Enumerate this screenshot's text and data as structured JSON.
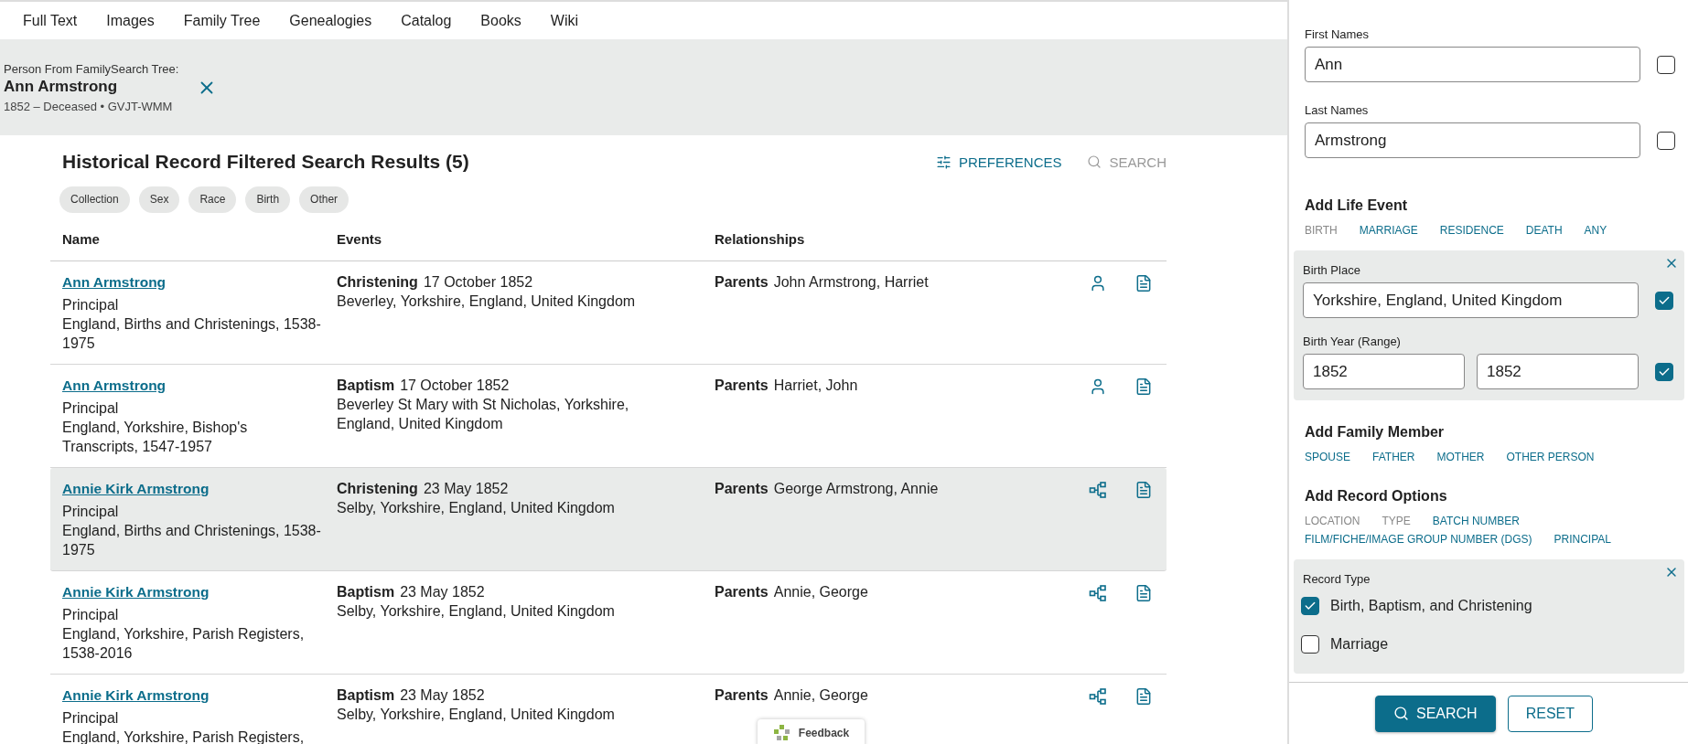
{
  "nav": {
    "items": [
      {
        "label": "Full Text"
      },
      {
        "label": "Images"
      },
      {
        "label": "Family Tree"
      },
      {
        "label": "Genealogies"
      },
      {
        "label": "Catalog"
      },
      {
        "label": "Books"
      },
      {
        "label": "Wiki"
      }
    ]
  },
  "person_banner": {
    "caption": "Person From FamilySearch Tree:",
    "name": "Ann Armstrong",
    "details": "1852 – Deceased • GVJT-WMM"
  },
  "results": {
    "title": "Historical Record Filtered Search Results (5)",
    "actions": [
      {
        "label": "PREFERENCES",
        "kind": "preferences",
        "disabled": false
      },
      {
        "label": "SEARCH",
        "kind": "search",
        "disabled": true
      }
    ],
    "filters": [
      "Collection",
      "Sex",
      "Race",
      "Birth",
      "Other"
    ],
    "columns": [
      "Name",
      "Events",
      "Relationships"
    ],
    "rows": [
      {
        "name": "Ann Armstrong",
        "role": "Principal",
        "collection": "England, Births and Christenings, 1538-1975",
        "event_type": "Christening",
        "event_date": "17 October 1852",
        "event_place": "Beverley, Yorkshire, England, United Kingdom",
        "relation_label": "Parents",
        "relation_names": "John Armstrong, Harriet",
        "kind": "person",
        "selected": false
      },
      {
        "name": "Ann Armstrong",
        "role": "Principal",
        "collection": "England, Yorkshire, Bishop's Transcripts, 1547-1957",
        "event_type": "Baptism",
        "event_date": "17 October 1852",
        "event_place": "Beverley St Mary with St Nicholas, Yorkshire, England, United Kingdom",
        "relation_label": "Parents",
        "relation_names": "Harriet, John",
        "kind": "person",
        "selected": false
      },
      {
        "name": "Annie Kirk Armstrong",
        "role": "Principal",
        "collection": "England, Births and Christenings, 1538-1975",
        "event_type": "Christening",
        "event_date": "23 May 1852",
        "event_place": "Selby, Yorkshire, England, United Kingdom",
        "relation_label": "Parents",
        "relation_names": "George Armstrong, Annie",
        "kind": "tree",
        "selected": true
      },
      {
        "name": "Annie Kirk Armstrong",
        "role": "Principal",
        "collection": "England, Yorkshire, Parish Registers, 1538-2016",
        "event_type": "Baptism",
        "event_date": "23 May 1852",
        "event_place": "Selby, Yorkshire, England, United Kingdom",
        "relation_label": "Parents",
        "relation_names": "Annie, George",
        "kind": "tree",
        "selected": false
      },
      {
        "name": "Annie Kirk Armstrong",
        "role": "Principal",
        "collection": "England, Yorkshire, Parish Registers,",
        "event_type": "Baptism",
        "event_date": "23 May 1852",
        "event_place": "Selby, Yorkshire, England, United Kingdom",
        "relation_label": "Parents",
        "relation_names": "Annie, George",
        "kind": "tree",
        "selected": false
      }
    ]
  },
  "feedback": {
    "label": "Feedback"
  },
  "search_panel": {
    "name_fields": [
      {
        "label": "First Names",
        "value": "Ann",
        "exact": false
      },
      {
        "label": "Last Names",
        "value": "Armstrong",
        "exact": false
      }
    ],
    "life_event": {
      "heading": "Add Life Event",
      "options": [
        {
          "label": "BIRTH",
          "disabled": true
        },
        {
          "label": "MARRIAGE",
          "disabled": false
        },
        {
          "label": "RESIDENCE",
          "disabled": false
        },
        {
          "label": "DEATH",
          "disabled": false
        },
        {
          "label": "ANY",
          "disabled": false
        }
      ],
      "birth": {
        "place_label": "Birth Place",
        "place_value": "Yorkshire, England, United Kingdom",
        "place_exact": true,
        "year_label": "Birth Year (Range)",
        "year_from": "1852",
        "year_to": "1852",
        "year_exact": true
      }
    },
    "family": {
      "heading": "Add Family Member",
      "options": [
        {
          "label": "SPOUSE",
          "disabled": false
        },
        {
          "label": "FATHER",
          "disabled": false
        },
        {
          "label": "MOTHER",
          "disabled": false
        },
        {
          "label": "OTHER PERSON",
          "disabled": false
        }
      ]
    },
    "record_options": {
      "heading": "Add Record Options",
      "options": [
        {
          "label": "LOCATION",
          "disabled": true
        },
        {
          "label": "TYPE",
          "disabled": true
        },
        {
          "label": "BATCH NUMBER",
          "disabled": false
        },
        {
          "label": "FILM/FICHE/IMAGE GROUP NUMBER (DGS)",
          "disabled": false
        },
        {
          "label": "PRINCIPAL",
          "disabled": false
        }
      ]
    },
    "record_type": {
      "label": "Record Type",
      "options": [
        {
          "label": "Birth, Baptism, and Christening",
          "checked": true
        },
        {
          "label": "Marriage",
          "checked": false
        }
      ]
    },
    "buttons": [
      {
        "label": "SEARCH",
        "kind": "primary"
      },
      {
        "label": "RESET",
        "kind": "secondary"
      }
    ]
  }
}
